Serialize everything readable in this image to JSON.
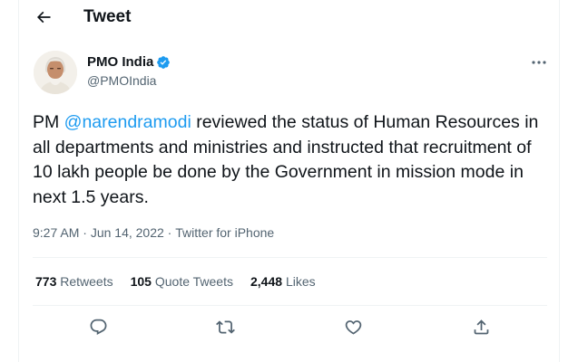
{
  "header": {
    "title": "Tweet",
    "back_icon": "arrow-left-icon"
  },
  "author": {
    "name": "PMO India",
    "handle": "@PMOIndia",
    "verified_icon": "verified-badge-icon",
    "verified_color": "#1d9bf0"
  },
  "tweet": {
    "text_before": "PM ",
    "mention": "@narendramodi",
    "text_after": " reviewed the status of Human Resources in all departments and ministries and instructed that recruitment of 10 lakh people be done by the Government in mission mode in next 1.5 years."
  },
  "meta": {
    "time": "9:27 AM",
    "separator": " · ",
    "date": "Jun 14, 2022",
    "source": "Twitter for iPhone"
  },
  "stats": {
    "retweets_count": "773",
    "retweets_label": "Retweets",
    "quotes_count": "105",
    "quotes_label": "Quote Tweets",
    "likes_count": "2,448",
    "likes_label": "Likes"
  },
  "actions": [
    "reply-icon",
    "retweet-icon",
    "like-icon",
    "share-icon"
  ],
  "colors": {
    "accent": "#1d9bf0",
    "text": "#0f1419",
    "secondary": "#536471",
    "divider": "#eff3f4"
  }
}
